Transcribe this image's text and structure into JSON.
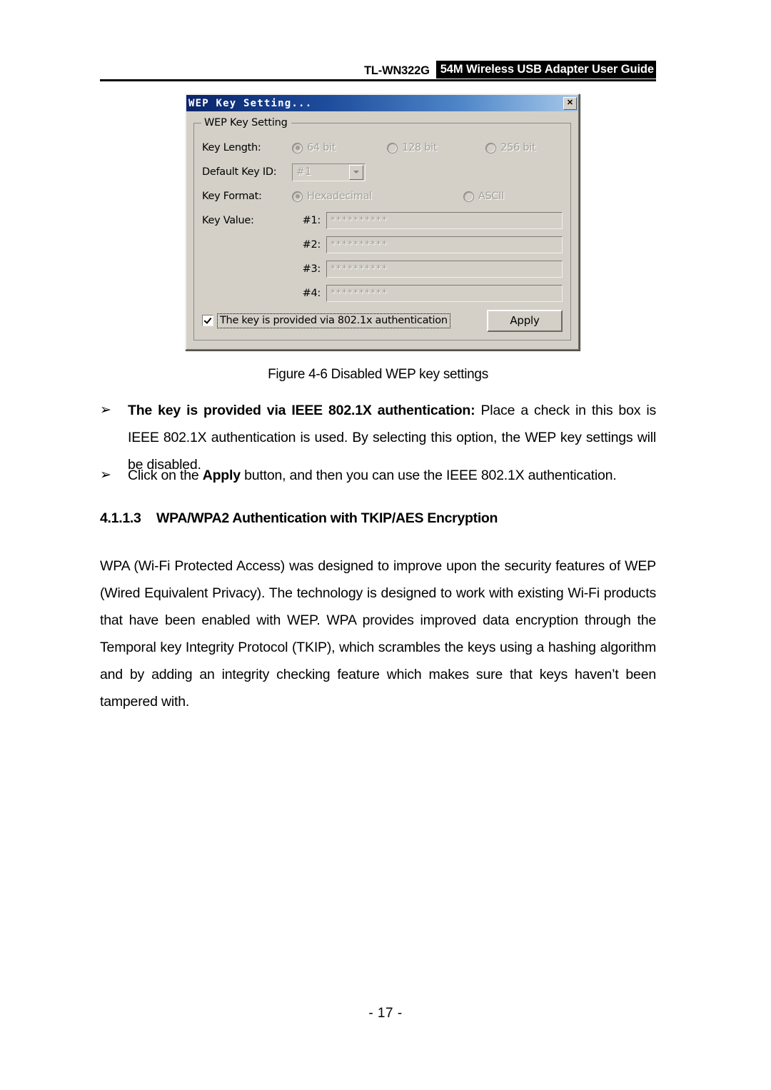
{
  "header": {
    "model": "TL-WN322G",
    "title": "54M Wireless USB Adapter User Guide"
  },
  "dialog": {
    "title": "WEP Key Setting...",
    "close_label": "✕",
    "group_legend": "WEP Key Setting",
    "key_length_label": "Key Length:",
    "key_length_options": [
      {
        "label": "64 bit",
        "selected": true
      },
      {
        "label": "128 bit",
        "selected": false
      },
      {
        "label": "256 bit",
        "selected": false
      }
    ],
    "default_key_id_label": "Default Key ID:",
    "default_key_id_value": "#1",
    "key_format_label": "Key Format:",
    "key_format_options": [
      {
        "label": "Hexadecimal",
        "selected": true
      },
      {
        "label": "ASCII",
        "selected": false
      }
    ],
    "key_value_label": "Key Value:",
    "key_values": [
      {
        "num": "#1:",
        "value": "**********"
      },
      {
        "num": "#2:",
        "value": "**********"
      },
      {
        "num": "#3:",
        "value": "**********"
      },
      {
        "num": "#4:",
        "value": "**********"
      }
    ],
    "checkbox_label": "The key is provided via 802.1x authentication",
    "checkbox_checked": true,
    "apply_label": "Apply",
    "colors": {
      "face": "#d4d0c8",
      "title_gradient_start": "#0a246a",
      "title_gradient_end": "#a6c8ea",
      "disabled_text": "#a3a09a"
    }
  },
  "content": {
    "figure_caption": "Figure 4-6 Disabled WEP key settings",
    "bullet_marker": "➢",
    "bullets": [
      {
        "bold_lead": "The key is provided via IEEE 802.1X authentication:",
        "text": " Place a check in this box is IEEE 802.1X authentication is used. By selecting this option, the WEP key settings will be disabled."
      },
      {
        "pre": "Click on the ",
        "bold_lead": "Apply",
        "text": " button, and then you can use the IEEE 802.1X authentication."
      }
    ],
    "section": {
      "number": "4.1.1.3",
      "title": "WPA/WPA2 Authentication with TKIP/AES Encryption"
    },
    "paragraph": "WPA (Wi-Fi Protected Access) was designed to improve upon the security features of WEP (Wired Equivalent Privacy). The technology is designed to work with existing Wi-Fi products that have been enabled with WEP. WPA provides improved data encryption through the Temporal key Integrity Protocol (TKIP), which scrambles the keys using a hashing algorithm and by adding an integrity checking feature which makes sure that keys haven’t been tampered with.",
    "page_number": "- 17 -"
  }
}
